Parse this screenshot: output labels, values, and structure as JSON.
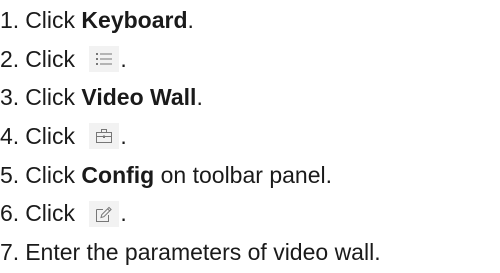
{
  "steps": [
    {
      "number": "1.",
      "before": "Click ",
      "bold": "Keyboard",
      "after": "."
    },
    {
      "number": "2.",
      "before": "Click ",
      "icon": "list-menu-icon",
      "after": "."
    },
    {
      "number": "3.",
      "before": "Click ",
      "bold": "Video Wall",
      "after": "."
    },
    {
      "number": "4.",
      "before": "Click ",
      "icon": "briefcase-icon",
      "after": "."
    },
    {
      "number": "5.",
      "before": "Click ",
      "bold": "Config",
      "after": " on toolbar panel."
    },
    {
      "number": "6.",
      "before": "Click ",
      "icon": "edit-icon",
      "after": "."
    },
    {
      "number": "7.",
      "text": "Enter the parameters of video wall."
    }
  ]
}
